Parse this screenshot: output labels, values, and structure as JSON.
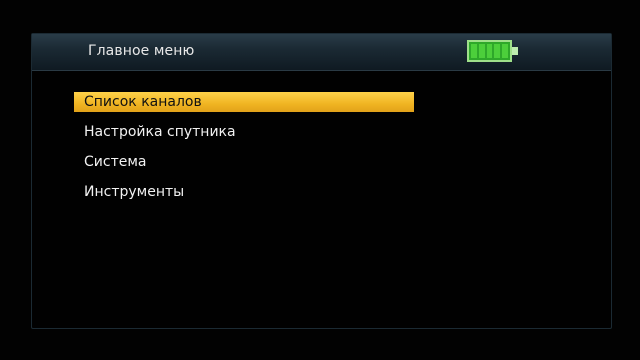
{
  "window": {
    "title": "Главное меню"
  },
  "battery": {
    "level": 1.0,
    "icon": "battery-full-icon"
  },
  "menu": {
    "items": [
      {
        "label": "Список каналов",
        "selected": true
      },
      {
        "label": "Настройка спутника",
        "selected": false
      },
      {
        "label": "Система",
        "selected": false
      },
      {
        "label": "Инструменты",
        "selected": false
      }
    ]
  },
  "colors": {
    "selected_bg": "#f0b422",
    "text": "#f2f2f2",
    "battery": "#4ccf3b"
  }
}
